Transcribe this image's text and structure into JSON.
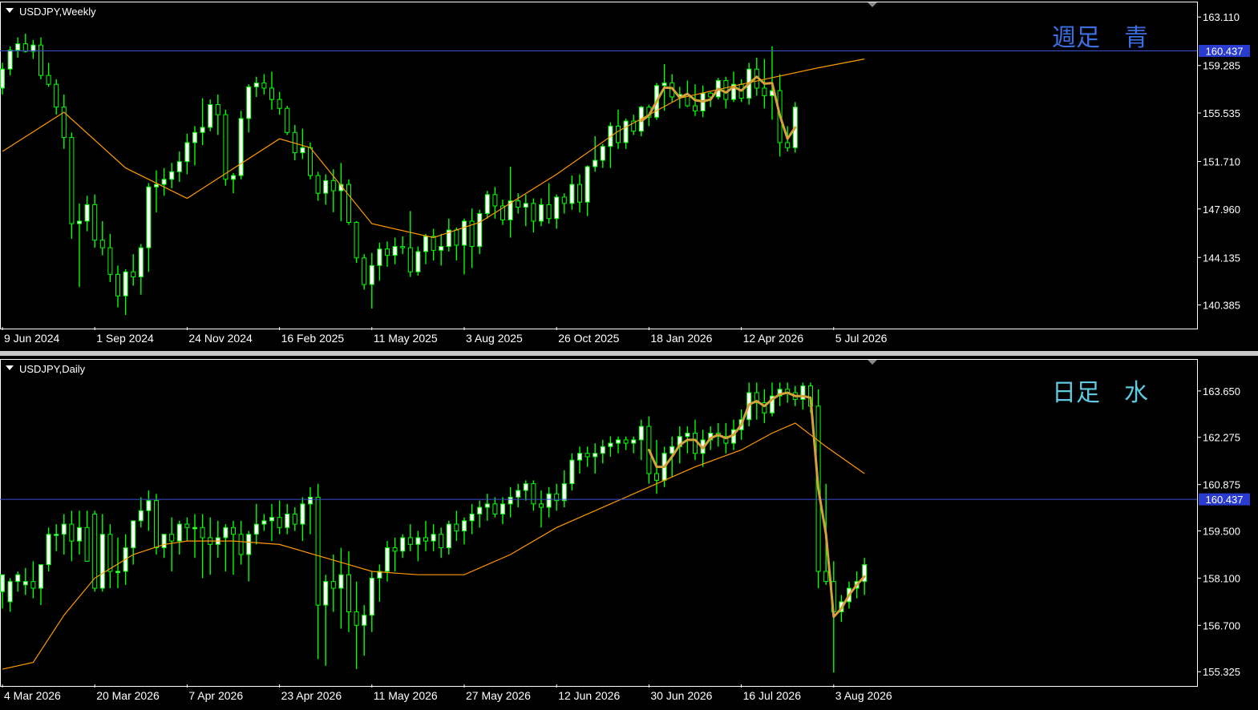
{
  "colors": {
    "background": "#000000",
    "frame": "#ffffff",
    "bull_candle": "#ffffff",
    "bear_candle": "#000000",
    "wick": "#00ff00",
    "moving_average": "#ff9900",
    "hline": "#3f4fd6",
    "hline_label_bg": "#2a3bd0",
    "annotation_stroke": "#d4a23a",
    "weekly_note": "#3b6fe0",
    "daily_note": "#5fc9e0",
    "text": "#ffffff"
  },
  "icons": {
    "dropdown": "triangle-down-icon",
    "scroll_marker": "triangle-down-icon"
  },
  "chart_data": [
    {
      "type": "candlestick",
      "title": "USDJPY,Weekly",
      "annotation": "週足　青",
      "ylim": [
        138.65,
        164.2
      ],
      "y_ticks": [
        "163.110",
        "159.285",
        "155.535",
        "151.710",
        "147.960",
        "144.135",
        "140.385"
      ],
      "hline_value": 160.437,
      "hline_label": "160.437",
      "x_tick_labels": [
        "9 Jun 2024",
        "1 Sep 2024",
        "24 Nov 2024",
        "16 Feb 2025",
        "11 May 2025",
        "3 Aug 2025",
        "26 Oct 2025",
        "18 Jan 2026",
        "12 Apr 2026",
        "5 Jul 2026"
      ],
      "x_tick_index": [
        0,
        12,
        24,
        36,
        48,
        60,
        72,
        84,
        96,
        108
      ],
      "moving_average": {
        "idx": [
          0,
          8,
          16,
          24,
          36,
          40,
          48,
          56,
          62,
          72,
          80,
          88,
          96,
          106,
          112
        ],
        "values": [
          152.5,
          155.6,
          151.2,
          148.8,
          153.5,
          152.8,
          146.8,
          145.7,
          146.9,
          150.7,
          154.1,
          156.7,
          157.8,
          159.1,
          159.8
        ]
      },
      "ohlc": [
        [
          157.5,
          159.5,
          157.0,
          159.0
        ],
        [
          159.0,
          160.8,
          158.5,
          160.5
        ],
        [
          160.5,
          161.5,
          159.9,
          161.0
        ],
        [
          161.0,
          161.8,
          160.3,
          160.4
        ],
        [
          160.4,
          161.3,
          159.8,
          160.9
        ],
        [
          160.9,
          161.5,
          158.2,
          158.5
        ],
        [
          158.5,
          159.5,
          157.6,
          157.8
        ],
        [
          157.8,
          158.2,
          155.4,
          156.0
        ],
        [
          156.0,
          157.0,
          152.7,
          153.6
        ],
        [
          153.6,
          154.0,
          145.6,
          146.8
        ],
        [
          146.8,
          148.4,
          141.8,
          147.0
        ],
        [
          147.0,
          149.0,
          146.2,
          148.3
        ],
        [
          148.3,
          149.1,
          144.9,
          145.5
        ],
        [
          145.5,
          147.0,
          144.3,
          144.9
        ],
        [
          144.9,
          146.0,
          142.2,
          142.8
        ],
        [
          142.8,
          143.5,
          140.2,
          141.1
        ],
        [
          141.1,
          143.2,
          139.6,
          143.0
        ],
        [
          143.0,
          144.4,
          141.9,
          142.6
        ],
        [
          142.6,
          145.2,
          141.2,
          144.9
        ],
        [
          144.9,
          150.0,
          143.0,
          149.7
        ],
        [
          149.7,
          151.0,
          147.7,
          149.9
        ],
        [
          149.9,
          151.2,
          149.0,
          150.3
        ],
        [
          150.3,
          151.6,
          149.6,
          150.9
        ],
        [
          150.9,
          152.5,
          150.1,
          151.7
        ],
        [
          151.7,
          153.9,
          150.7,
          153.2
        ],
        [
          153.2,
          154.5,
          151.4,
          154.0
        ],
        [
          154.0,
          156.7,
          153.0,
          154.4
        ],
        [
          154.4,
          156.6,
          154.1,
          156.2
        ],
        [
          156.2,
          157.0,
          153.8,
          155.4
        ],
        [
          155.4,
          155.8,
          149.8,
          150.3
        ],
        [
          150.3,
          150.8,
          149.2,
          150.6
        ],
        [
          150.6,
          155.7,
          150.3,
          155.1
        ],
        [
          155.1,
          157.8,
          154.0,
          157.6
        ],
        [
          157.6,
          158.4,
          156.8,
          157.9
        ],
        [
          157.9,
          158.6,
          157.0,
          157.5
        ],
        [
          157.5,
          158.8,
          155.8,
          156.6
        ],
        [
          156.6,
          157.2,
          155.4,
          155.9
        ],
        [
          155.9,
          156.1,
          153.8,
          154.0
        ],
        [
          154.0,
          154.6,
          151.8,
          152.4
        ],
        [
          152.4,
          154.3,
          151.9,
          152.8
        ],
        [
          152.8,
          153.2,
          150.3,
          150.6
        ],
        [
          150.6,
          150.9,
          148.6,
          149.2
        ],
        [
          149.2,
          150.7,
          148.3,
          150.2
        ],
        [
          150.2,
          151.1,
          147.7,
          149.4
        ],
        [
          149.4,
          151.6,
          147.0,
          149.9
        ],
        [
          149.9,
          150.3,
          146.7,
          146.9
        ],
        [
          146.9,
          147.0,
          143.7,
          144.1
        ],
        [
          144.1,
          144.4,
          141.6,
          142.0
        ],
        [
          142.0,
          144.5,
          140.1,
          143.5
        ],
        [
          143.5,
          145.3,
          142.3,
          144.8
        ],
        [
          144.8,
          145.4,
          143.4,
          144.3
        ],
        [
          144.3,
          145.7,
          143.6,
          145.0
        ],
        [
          145.0,
          145.8,
          144.4,
          144.9
        ],
        [
          144.9,
          147.8,
          142.6,
          143.0
        ],
        [
          143.0,
          145.0,
          142.7,
          144.6
        ],
        [
          144.6,
          146.0,
          143.6,
          145.8
        ],
        [
          145.8,
          146.4,
          143.9,
          144.7
        ],
        [
          144.7,
          146.0,
          143.5,
          145.0
        ],
        [
          145.0,
          147.2,
          144.6,
          146.3
        ],
        [
          146.3,
          146.5,
          143.9,
          145.1
        ],
        [
          145.1,
          147.2,
          142.8,
          147.0
        ],
        [
          147.0,
          148.0,
          143.3,
          145.0
        ],
        [
          145.0,
          147.9,
          144.4,
          147.6
        ],
        [
          147.6,
          149.4,
          147.2,
          149.1
        ],
        [
          149.1,
          149.7,
          147.2,
          148.2
        ],
        [
          148.2,
          148.7,
          146.7,
          147.1
        ],
        [
          147.1,
          151.3,
          145.7,
          148.6
        ],
        [
          148.6,
          149.2,
          147.6,
          148.1
        ],
        [
          148.1,
          149.1,
          146.6,
          148.4
        ],
        [
          148.4,
          148.8,
          146.1,
          147.0
        ],
        [
          147.0,
          148.8,
          146.6,
          148.3
        ],
        [
          148.3,
          150.0,
          146.8,
          147.2
        ],
        [
          147.2,
          149.1,
          146.4,
          148.9
        ],
        [
          148.9,
          149.2,
          147.6,
          148.4
        ],
        [
          148.4,
          150.6,
          147.9,
          149.9
        ],
        [
          149.9,
          150.7,
          147.7,
          148.5
        ],
        [
          148.5,
          151.4,
          147.4,
          151.3
        ],
        [
          151.3,
          153.7,
          150.9,
          151.8
        ],
        [
          151.8,
          153.1,
          151.2,
          152.9
        ],
        [
          152.9,
          154.8,
          151.2,
          154.5
        ],
        [
          154.5,
          155.8,
          152.7,
          153.2
        ],
        [
          153.2,
          155.1,
          152.7,
          154.9
        ],
        [
          154.9,
          155.4,
          153.8,
          154.1
        ],
        [
          154.1,
          156.1,
          153.7,
          156.0
        ],
        [
          156.0,
          156.2,
          154.5,
          155.2
        ],
        [
          155.2,
          157.9,
          155.0,
          157.7
        ],
        [
          157.7,
          159.4,
          155.7,
          157.9
        ],
        [
          157.9,
          158.6,
          156.4,
          156.8
        ],
        [
          156.8,
          157.6,
          155.9,
          157.0
        ],
        [
          157.0,
          158.1,
          156.0,
          156.1
        ],
        [
          156.1,
          157.8,
          155.3,
          155.7
        ],
        [
          155.7,
          157.7,
          155.2,
          157.1
        ],
        [
          157.1,
          157.2,
          156.0,
          156.8
        ],
        [
          156.8,
          158.3,
          156.6,
          158.1
        ],
        [
          158.1,
          158.4,
          155.9,
          156.6
        ],
        [
          156.6,
          158.8,
          156.4,
          157.8
        ],
        [
          157.8,
          158.2,
          156.4,
          156.7
        ],
        [
          156.7,
          159.5,
          156.2,
          159.0
        ],
        [
          159.0,
          159.9,
          156.9,
          157.5
        ],
        [
          157.5,
          159.8,
          155.9,
          156.9
        ],
        [
          156.9,
          160.8,
          155.0,
          157.3
        ],
        [
          157.3,
          158.6,
          152.1,
          153.2
        ],
        [
          153.2,
          154.5,
          152.5,
          152.8
        ],
        [
          152.8,
          156.4,
          152.4,
          156.0
        ]
      ],
      "weekly_ohlc_tail": "see plotted series"
    },
    {
      "type": "candlestick",
      "title": "USDJPY,Daily",
      "annotation": "日足　水",
      "ylim": [
        154.95,
        164.55
      ],
      "y_ticks": [
        "163.650",
        "162.275",
        "160.875",
        "159.500",
        "158.100",
        "156.700",
        "155.325"
      ],
      "hline_value": 160.437,
      "hline_label": "160.437",
      "x_tick_labels": [
        "4 Mar 2026",
        "20 Mar 2026",
        "7 Apr 2026",
        "23 Apr 2026",
        "11 May 2026",
        "27 May 2026",
        "12 Jun 2026",
        "30 Jun 2026",
        "16 Jul 2026",
        "3 Aug 2026"
      ],
      "x_tick_index": [
        0,
        12,
        24,
        36,
        48,
        60,
        72,
        84,
        96,
        108
      ],
      "moving_average": {
        "idx": [
          0,
          4,
          8,
          12,
          17,
          21,
          24,
          30,
          36,
          45,
          48,
          54,
          60,
          66,
          72,
          78,
          84,
          90,
          96,
          100,
          103,
          107,
          112
        ],
        "values": [
          155.4,
          155.6,
          157.0,
          158.1,
          158.8,
          159.1,
          159.2,
          159.2,
          159.1,
          158.5,
          158.3,
          158.2,
          158.2,
          158.8,
          159.6,
          160.2,
          160.8,
          161.4,
          161.9,
          162.4,
          162.7,
          162.0,
          161.2
        ]
      },
      "series_values": "candles drawn from ohlc",
      "ohlc_tail": ""
    }
  ],
  "daily_ohlc": [
    [
      157.7,
      158.1,
      157.2,
      158.2
    ],
    [
      157.4,
      158.1,
      157.1,
      158.0
    ],
    [
      158.0,
      158.3,
      157.7,
      158.2
    ],
    [
      157.9,
      158.4,
      157.6,
      158.0
    ],
    [
      158.0,
      158.6,
      157.5,
      157.8
    ],
    [
      157.8,
      158.4,
      157.3,
      158.5
    ],
    [
      158.5,
      159.6,
      158.3,
      159.4
    ],
    [
      159.4,
      159.7,
      158.9,
      159.4
    ],
    [
      159.4,
      160.0,
      158.8,
      159.7
    ],
    [
      159.7,
      160.1,
      158.6,
      159.2
    ],
    [
      159.2,
      160.1,
      158.8,
      159.6
    ],
    [
      159.6,
      160.1,
      159.0,
      158.6
    ],
    [
      160.0,
      160.1,
      157.7,
      157.8
    ],
    [
      157.8,
      160.0,
      157.7,
      159.4
    ],
    [
      159.4,
      159.7,
      157.8,
      158.3
    ],
    [
      158.3,
      159.3,
      157.8,
      158.3
    ],
    [
      158.3,
      159.4,
      157.9,
      159.0
    ],
    [
      159.0,
      159.8,
      158.5,
      159.8
    ],
    [
      159.8,
      160.5,
      159.6,
      160.1
    ],
    [
      160.1,
      160.7,
      159.5,
      160.4
    ],
    [
      160.4,
      160.6,
      158.8,
      159.0
    ],
    [
      159.0,
      159.4,
      158.7,
      159.4
    ],
    [
      159.4,
      159.9,
      158.3,
      159.2
    ],
    [
      159.2,
      159.8,
      158.8,
      159.7
    ],
    [
      159.7,
      159.9,
      159.2,
      159.6
    ],
    [
      159.6,
      160.0,
      158.7,
      159.6
    ],
    [
      159.6,
      160.0,
      158.1,
      159.3
    ],
    [
      159.3,
      159.9,
      158.2,
      159.1
    ],
    [
      159.1,
      159.8,
      158.7,
      159.3
    ],
    [
      159.3,
      159.7,
      158.3,
      159.6
    ],
    [
      159.6,
      159.8,
      158.2,
      159.4
    ],
    [
      159.4,
      159.8,
      158.5,
      158.8
    ],
    [
      158.8,
      159.5,
      158.0,
      159.4
    ],
    [
      159.4,
      160.3,
      159.1,
      159.7
    ],
    [
      159.7,
      160.0,
      159.5,
      159.8
    ],
    [
      159.8,
      160.3,
      159.2,
      159.9
    ],
    [
      159.9,
      160.4,
      159.4,
      159.6
    ],
    [
      159.6,
      160.3,
      159.4,
      160.0
    ],
    [
      160.0,
      160.2,
      159.5,
      159.7
    ],
    [
      159.7,
      160.5,
      159.2,
      160.3
    ],
    [
      160.3,
      160.8,
      159.4,
      160.5
    ],
    [
      160.5,
      160.9,
      155.7,
      157.3
    ],
    [
      157.3,
      158.2,
      155.5,
      158.0
    ],
    [
      158.0,
      158.8,
      157.1,
      157.8
    ],
    [
      157.8,
      159.0,
      156.6,
      158.2
    ],
    [
      158.2,
      158.9,
      156.5,
      157.1
    ],
    [
      157.1,
      158.0,
      155.4,
      156.7
    ],
    [
      156.7,
      157.3,
      155.8,
      157.0
    ],
    [
      157.0,
      158.3,
      156.5,
      158.1
    ],
    [
      158.1,
      158.5,
      157.4,
      158.3
    ],
    [
      158.3,
      159.2,
      158.0,
      159.0
    ],
    [
      159.0,
      159.3,
      158.3,
      158.9
    ],
    [
      158.9,
      159.4,
      158.7,
      159.3
    ],
    [
      159.3,
      159.7,
      158.9,
      159.1
    ],
    [
      159.1,
      159.5,
      158.6,
      159.3
    ],
    [
      159.3,
      159.8,
      158.9,
      159.2
    ],
    [
      159.2,
      159.7,
      158.9,
      159.4
    ],
    [
      159.4,
      159.6,
      158.7,
      159.0
    ],
    [
      159.0,
      159.8,
      158.8,
      159.7
    ],
    [
      159.7,
      160.1,
      159.2,
      159.5
    ],
    [
      159.5,
      159.9,
      159.1,
      159.8
    ],
    [
      159.8,
      160.3,
      159.4,
      160.0
    ],
    [
      160.0,
      160.4,
      159.6,
      160.2
    ],
    [
      160.2,
      160.6,
      159.8,
      160.3
    ],
    [
      160.3,
      160.5,
      159.9,
      160.0
    ],
    [
      160.0,
      160.5,
      159.7,
      160.3
    ],
    [
      160.3,
      160.8,
      159.9,
      160.5
    ],
    [
      160.5,
      160.9,
      160.2,
      160.7
    ],
    [
      160.7,
      161.0,
      160.4,
      160.9
    ],
    [
      160.9,
      161.0,
      160.1,
      160.3
    ],
    [
      160.3,
      160.7,
      159.6,
      160.2
    ],
    [
      160.2,
      160.8,
      159.9,
      160.6
    ],
    [
      160.6,
      160.9,
      160.1,
      160.4
    ],
    [
      160.4,
      161.3,
      160.2,
      160.9
    ],
    [
      160.9,
      161.8,
      160.7,
      161.6
    ],
    [
      161.6,
      162.0,
      161.2,
      161.8
    ],
    [
      161.8,
      162.0,
      161.4,
      161.7
    ],
    [
      161.7,
      162.1,
      161.2,
      161.8
    ],
    [
      161.8,
      162.2,
      161.5,
      162.0
    ],
    [
      162.0,
      162.3,
      161.7,
      162.1
    ],
    [
      162.1,
      162.3,
      161.8,
      162.2
    ],
    [
      162.2,
      162.3,
      161.9,
      162.1
    ],
    [
      162.1,
      162.3,
      161.8,
      162.2
    ],
    [
      162.2,
      162.8,
      161.6,
      162.6
    ],
    [
      162.6,
      162.9,
      160.9,
      161.2
    ],
    [
      161.2,
      162.2,
      160.6,
      161.0
    ],
    [
      161.0,
      162.0,
      160.8,
      161.8
    ],
    [
      161.8,
      162.3,
      161.1,
      162.0
    ],
    [
      162.0,
      162.6,
      161.5,
      162.3
    ],
    [
      162.3,
      162.6,
      161.8,
      162.4
    ],
    [
      162.4,
      162.8,
      161.6,
      161.8
    ],
    [
      161.8,
      162.5,
      161.4,
      162.2
    ],
    [
      162.2,
      162.6,
      161.9,
      162.4
    ],
    [
      162.4,
      162.7,
      162.0,
      162.3
    ],
    [
      162.3,
      162.7,
      161.8,
      162.1
    ],
    [
      162.1,
      162.8,
      161.9,
      162.5
    ],
    [
      162.5,
      163.1,
      162.2,
      162.8
    ],
    [
      162.8,
      163.9,
      162.6,
      163.6
    ],
    [
      163.6,
      163.9,
      162.8,
      163.3
    ],
    [
      163.3,
      163.7,
      162.7,
      163.0
    ],
    [
      163.0,
      163.9,
      162.9,
      163.5
    ],
    [
      163.5,
      163.9,
      163.2,
      163.7
    ],
    [
      163.7,
      163.9,
      163.3,
      163.6
    ],
    [
      163.6,
      163.8,
      163.2,
      163.4
    ],
    [
      163.4,
      163.9,
      163.1,
      163.8
    ],
    [
      163.8,
      163.9,
      163.0,
      163.2
    ],
    [
      163.2,
      163.7,
      157.8,
      158.3
    ],
    [
      158.3,
      160.9,
      157.9,
      158.0
    ],
    [
      158.0,
      158.6,
      155.3,
      157.1
    ],
    [
      157.1,
      157.6,
      156.8,
      157.4
    ],
    [
      157.4,
      158.0,
      157.2,
      157.8
    ],
    [
      157.8,
      158.3,
      157.5,
      158.0
    ],
    [
      158.0,
      158.7,
      157.6,
      158.5
    ]
  ]
}
